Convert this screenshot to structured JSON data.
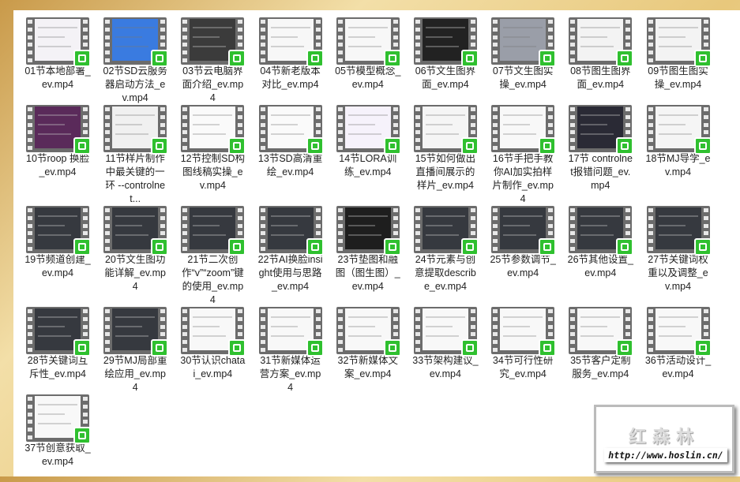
{
  "files": [
    {
      "name": "01节本地部署_ev.mp4",
      "tone": "#f4f2f6"
    },
    {
      "name": "02节SD云服务器启动方法_ev.mp4",
      "tone": "#3a7be0"
    },
    {
      "name": "03节云电脑界面介绍_ev.mp4",
      "tone": "#3b3b3b"
    },
    {
      "name": "04节新老版本对比_ev.mp4",
      "tone": "#f7f7f7"
    },
    {
      "name": "05节模型概念_ev.mp4",
      "tone": "#f7f7f7"
    },
    {
      "name": "06节文生图界面_ev.mp4",
      "tone": "#222222"
    },
    {
      "name": "07节文生图实操_ev.mp4",
      "tone": "#9a9ea8"
    },
    {
      "name": "08节图生图界面_ev.mp4",
      "tone": "#f3f3f3"
    },
    {
      "name": "09节图生图实操_ev.mp4",
      "tone": "#f3f3f3"
    },
    {
      "name": "10节roop 换脸_ev.mp4",
      "tone": "#5a2a5a"
    },
    {
      "name": "11节样片制作中最关键的一环 --controlnet...",
      "tone": "#f0f0f0"
    },
    {
      "name": "12节控制SD构图线稿实操_ev.mp4",
      "tone": "#fafafa"
    },
    {
      "name": "13节SD高清重绘_ev.mp4",
      "tone": "#fafafa"
    },
    {
      "name": "14节LORA训练_ev.mp4",
      "tone": "#f6f2fb"
    },
    {
      "name": "15节如何做出直播间展示的样片_ev.mp4",
      "tone": "#f5f5f5"
    },
    {
      "name": "16节手把手教你AI加实拍样片制作_ev.mp4",
      "tone": "#f8f8f8"
    },
    {
      "name": "17节 controlnet报错问题_ev.mp4",
      "tone": "#2a2a35"
    },
    {
      "name": "18节MJ导学_ev.mp4",
      "tone": "#f5f5f5"
    },
    {
      "name": "19节频道创建_ev.mp4",
      "tone": "#36393f"
    },
    {
      "name": "20节文生图功能详解_ev.mp4",
      "tone": "#36393f"
    },
    {
      "name": "21节二次创作“v”“zoom”键的使用_ev.mp4",
      "tone": "#36393f"
    },
    {
      "name": "22节AI换脸insight使用与思路_ev.mp4",
      "tone": "#36393f"
    },
    {
      "name": "23节垫图和融图（图生图）_ev.mp4",
      "tone": "#1e1e1e"
    },
    {
      "name": "24节元素与创意提取describe_ev.mp4",
      "tone": "#36393f"
    },
    {
      "name": "25节参数调节_ev.mp4",
      "tone": "#36393f"
    },
    {
      "name": "26节其他设置_ev.mp4",
      "tone": "#36393f"
    },
    {
      "name": "27节关键词权重以及调整_ev.mp4",
      "tone": "#36393f"
    },
    {
      "name": "28节关键词互斥性_ev.mp4",
      "tone": "#36393f"
    },
    {
      "name": "29节MJ局部重绘应用_ev.mp4",
      "tone": "#36393f"
    },
    {
      "name": "30节认识chatai_ev.mp4",
      "tone": "#f8f8f8"
    },
    {
      "name": "31节新媒体运营方案_ev.mp4",
      "tone": "#f8f8f8"
    },
    {
      "name": "32节新媒体文案_ev.mp4",
      "tone": "#f8f8f8"
    },
    {
      "name": "33节架构建议_ev.mp4",
      "tone": "#f8f8f8"
    },
    {
      "name": "34节可行性研究_ev.mp4",
      "tone": "#f8f8f8"
    },
    {
      "name": "35节客户定制服务_ev.mp4",
      "tone": "#f8f8f8"
    },
    {
      "name": "36节活动设计_ev.mp4",
      "tone": "#f8f8f8"
    },
    {
      "name": "37节创意获取_ev.mp4",
      "tone": "#f8f8f8"
    }
  ],
  "watermark": {
    "title": "红森林",
    "url": "http://www.hoslin.cn/"
  }
}
